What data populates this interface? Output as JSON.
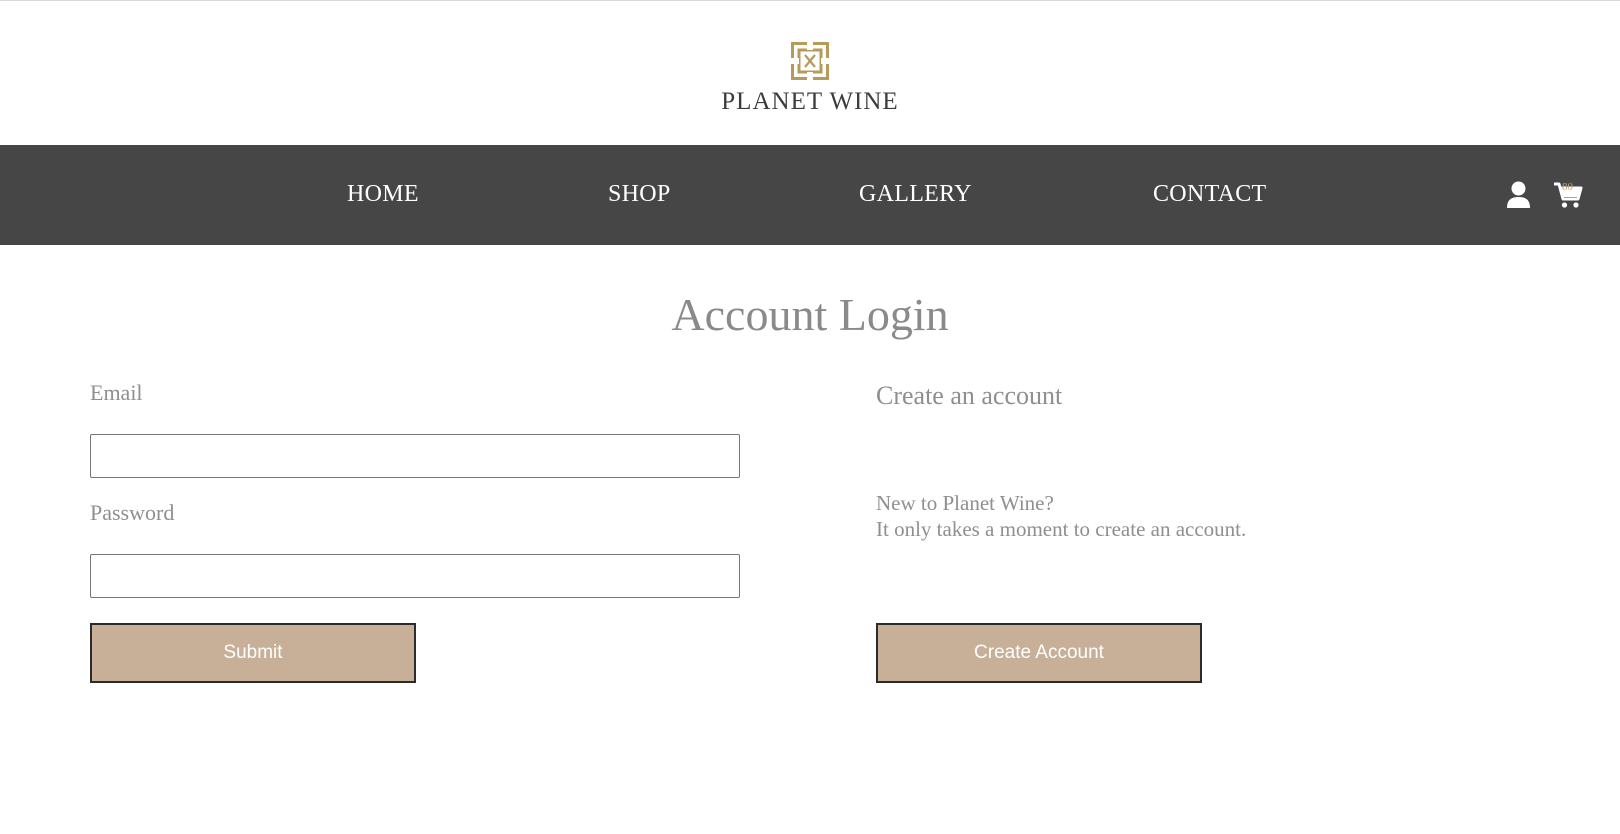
{
  "header": {
    "brand_name": "PLANET WINE",
    "logo_icon": "planet-wine-logo-mark",
    "logo_color": "#b59a58"
  },
  "nav": {
    "items": [
      {
        "label": "HOME"
      },
      {
        "label": "SHOP"
      },
      {
        "label": "GALLERY"
      },
      {
        "label": "CONTACT"
      }
    ],
    "account_icon": "user-icon",
    "cart_icon": "cart-icon",
    "cart_count": "80",
    "background": "#464646"
  },
  "main": {
    "title": "Account Login",
    "login": {
      "email_label": "Email",
      "email_value": "",
      "password_label": "Password",
      "password_value": "",
      "submit_label": "Submit"
    },
    "create": {
      "heading": "Create an account",
      "line1": "New to Planet Wine?",
      "line2": "It only takes a moment to create an account.",
      "button_label": "Create Account"
    }
  },
  "colors": {
    "button_bg": "#c7af98",
    "text_muted": "#8f8f8f"
  }
}
